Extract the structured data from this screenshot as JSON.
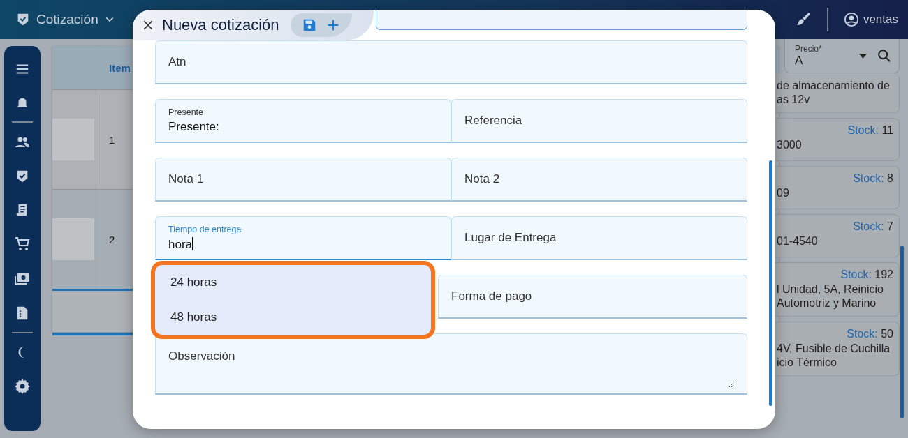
{
  "top_bar": {
    "module": "Cotización",
    "user": "ventas"
  },
  "table": {
    "columns": [
      "Item"
    ],
    "rows": [
      {
        "item": "1"
      },
      {
        "item": "2"
      }
    ]
  },
  "price_filter": {
    "label": "Precio*",
    "value": "A"
  },
  "products": [
    {
      "lines": [
        "de almacenamiento de",
        "as 12v"
      ]
    },
    {
      "stock_label": "Stock:",
      "stock_value": "11",
      "lines": [
        "3000"
      ]
    },
    {
      "stock_label": "Stock:",
      "stock_value": "8",
      "lines": [
        "09"
      ]
    },
    {
      "stock_label": "Stock:",
      "stock_value": "7",
      "lines": [
        "01-4540"
      ]
    },
    {
      "stock_label": "Stock:",
      "stock_value": "192",
      "lines": [
        "l Unidad, 5A, Reinicio",
        "Automotriz y Marino"
      ]
    },
    {
      "stock_label": "Stock:",
      "stock_value": "50",
      "lines": [
        "4V, Fusible de Cuchilla",
        "icio Térmico"
      ]
    }
  ],
  "dialog": {
    "title": "Nueva cotización",
    "rows": [
      [
        {
          "kind": "text",
          "placeholder": "Atn"
        }
      ],
      [
        {
          "kind": "text",
          "label": "Presente",
          "value": "Presente:",
          "focused": false
        },
        {
          "kind": "text",
          "placeholder": "Referencia"
        }
      ],
      [
        {
          "kind": "text",
          "placeholder": "Nota 1"
        },
        {
          "kind": "text",
          "placeholder": "Nota 2"
        }
      ],
      [
        {
          "kind": "text",
          "label": "Tiempo de entrega",
          "value": "hora",
          "focused": true
        },
        {
          "kind": "text",
          "placeholder": "Lugar de Entrega"
        }
      ],
      [
        {
          "kind": "suggestions",
          "highlighted": true,
          "options": [
            {
              "text": "24 horas",
              "selected": false
            },
            {
              "text": "48 horas",
              "selected": false
            }
          ]
        },
        {
          "kind": "text",
          "placeholder": "Forma de pago"
        }
      ],
      [
        {
          "kind": "textarea",
          "placeholder": "Observación"
        }
      ]
    ]
  }
}
